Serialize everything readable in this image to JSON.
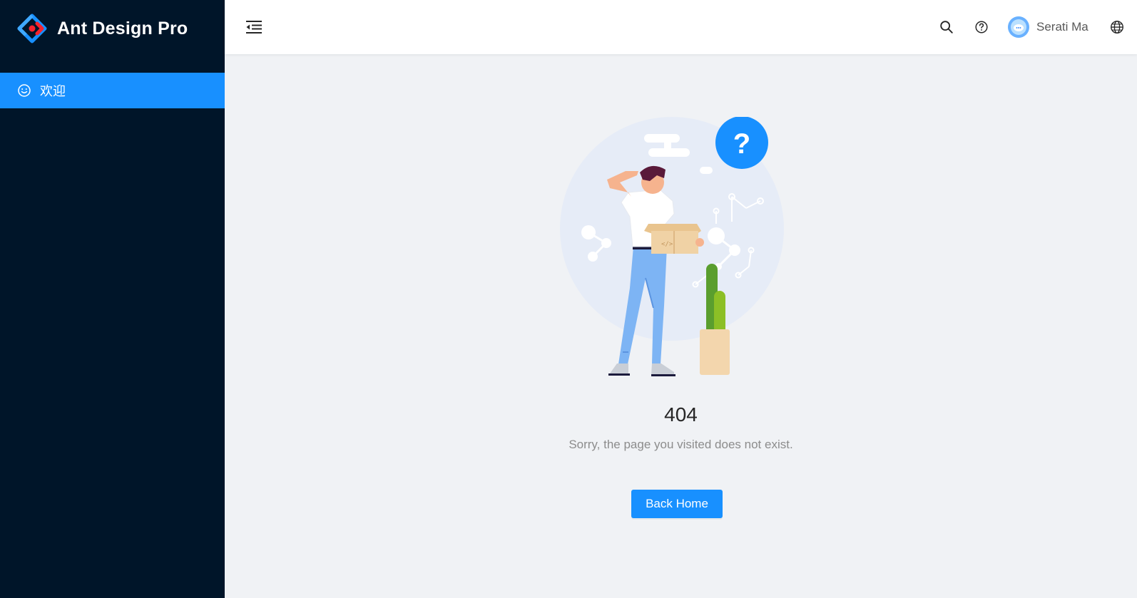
{
  "app": {
    "title": "Ant Design Pro",
    "brand_color": "#1890ff",
    "sider_color": "#001529"
  },
  "sidebar": {
    "items": [
      {
        "label": "欢迎",
        "icon": "smile-icon",
        "active": true
      }
    ]
  },
  "header": {
    "collapse_icon": "menu-fold-icon",
    "search_icon": "search-icon",
    "help_icon": "question-circle-icon",
    "user_name": "Serati Ma",
    "language_icon": "globe-icon"
  },
  "result": {
    "status": "404",
    "subtitle": "Sorry, the page you visited does not exist.",
    "button_label": "Back Home",
    "illustration": "person-holding-box-illustration"
  }
}
